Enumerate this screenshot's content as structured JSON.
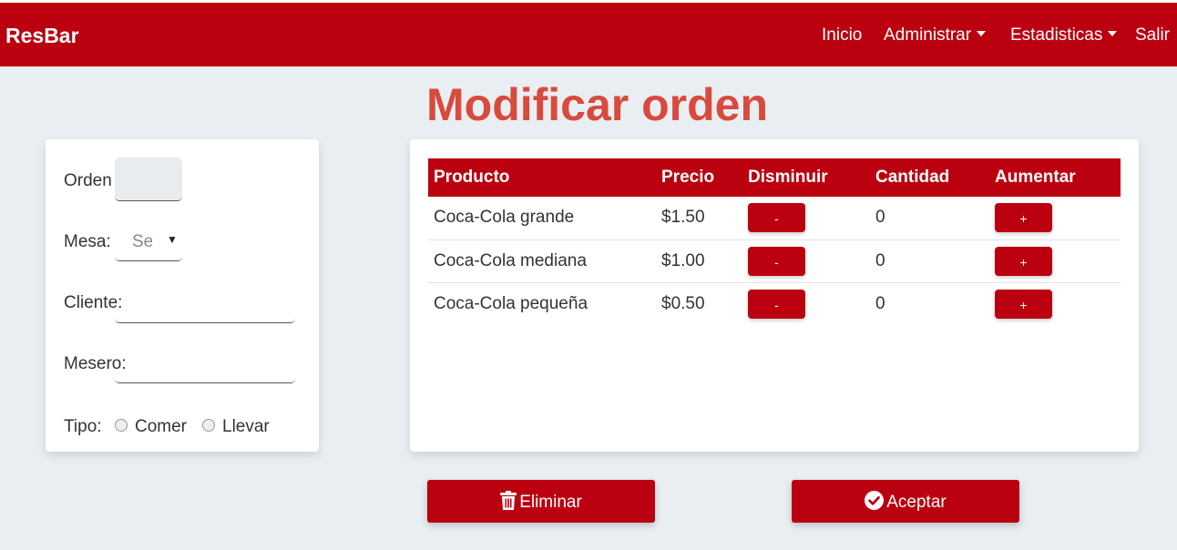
{
  "app": {
    "brand": "ResBar"
  },
  "nav": {
    "inicio": "Inicio",
    "administrar": "Administrar",
    "estadisticas": "Estadisticas",
    "salir": "Salir"
  },
  "page": {
    "title": "Modificar orden"
  },
  "form": {
    "orden_label": "Orden",
    "orden_value": "",
    "mesa_label": "Mesa:",
    "mesa_selected": "Seleccione",
    "cliente_label": "Cliente:",
    "cliente_value": "",
    "mesero_label": "Mesero:",
    "mesero_value": "",
    "tipo_label": "Tipo:",
    "tipo_options": [
      "Comer",
      "Llevar"
    ]
  },
  "table": {
    "headers": [
      "Producto",
      "Precio",
      "Disminuir",
      "Cantidad",
      "Aumentar"
    ],
    "rows": [
      {
        "producto": "Coca-Cola grande",
        "precio": "$1.50",
        "cantidad": "0"
      },
      {
        "producto": "Coca-Cola mediana",
        "precio": "$1.00",
        "cantidad": "0"
      },
      {
        "producto": "Coca-Cola pequeña",
        "precio": "$0.50",
        "cantidad": "0"
      }
    ],
    "decrease_label": "-",
    "increase_label": "+"
  },
  "actions": {
    "eliminar": "Eliminar",
    "aceptar": "Aceptar"
  },
  "icons": {
    "eliminar": "trash-icon",
    "aceptar": "check-circle-icon"
  },
  "colors": {
    "primary": "#bb0010",
    "title": "#d84a3d",
    "background": "#e9eef2"
  }
}
